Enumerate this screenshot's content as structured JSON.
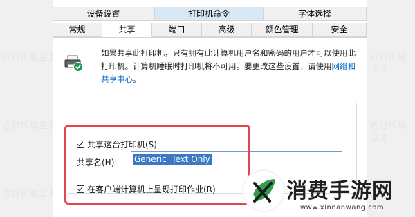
{
  "watermark": "@打印机卫士",
  "tabs_top": [
    {
      "label": "设备设置"
    },
    {
      "label": "打印机命令"
    },
    {
      "label": "字体选择"
    }
  ],
  "tabs_bottom": [
    {
      "label": "常规"
    },
    {
      "label": "共享"
    },
    {
      "label": "端口"
    },
    {
      "label": "高级"
    },
    {
      "label": "颜色管理"
    },
    {
      "label": "安全"
    }
  ],
  "info": {
    "text": "如果共享此打印机，只有拥有此计算机用户名和密码的用户才可以使用此打印机。计算机睡眠时打印机将不可用。要更改这些设置，请使用",
    "link": "网络和共享中心",
    "end": "。"
  },
  "share_checkbox": {
    "label": "共享这台打印机(S)",
    "checked": true
  },
  "share_name": {
    "label": "共享名(H):",
    "value": "Generic  Text Only"
  },
  "render_checkbox": {
    "label": "在客户端计算机上呈现打印作业(R)",
    "checked": true
  },
  "logo": {
    "title": "消费手游网",
    "url": "www.xinnanwang.com"
  },
  "colors": {
    "accent": "#3b79c4",
    "highlight": "#e3464d",
    "link": "#0066cc"
  }
}
